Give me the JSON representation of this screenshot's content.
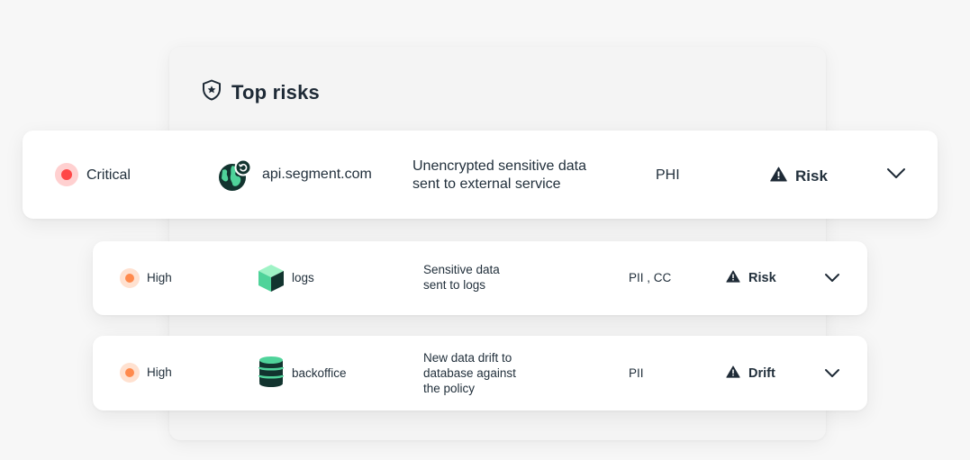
{
  "panel": {
    "title": "Top risks",
    "icon": "shield-star-icon"
  },
  "rows": [
    {
      "severity": "Critical",
      "severity_color": "#ff4848",
      "asset": "api.segment.com",
      "asset_icon": "globe-icon",
      "description_lines": [
        "Unencrypted sensitive data",
        "sent to external service"
      ],
      "data_types": "PHI",
      "type": "Risk",
      "type_icon": "warning-icon"
    },
    {
      "severity": "High",
      "severity_color": "#ff8a4d",
      "asset": "logs",
      "asset_icon": "cube-icon",
      "description_lines": [
        "Sensitive data",
        "sent to logs"
      ],
      "data_types": "PII , CC",
      "type": "Risk",
      "type_icon": "warning-icon"
    },
    {
      "severity": "High",
      "severity_color": "#ff8a4d",
      "asset": "backoffice",
      "asset_icon": "database-icon",
      "description_lines": [
        "New data drift to",
        "database against",
        "the policy"
      ],
      "data_types": "PII",
      "type": "Drift",
      "type_icon": "warning-icon"
    }
  ]
}
